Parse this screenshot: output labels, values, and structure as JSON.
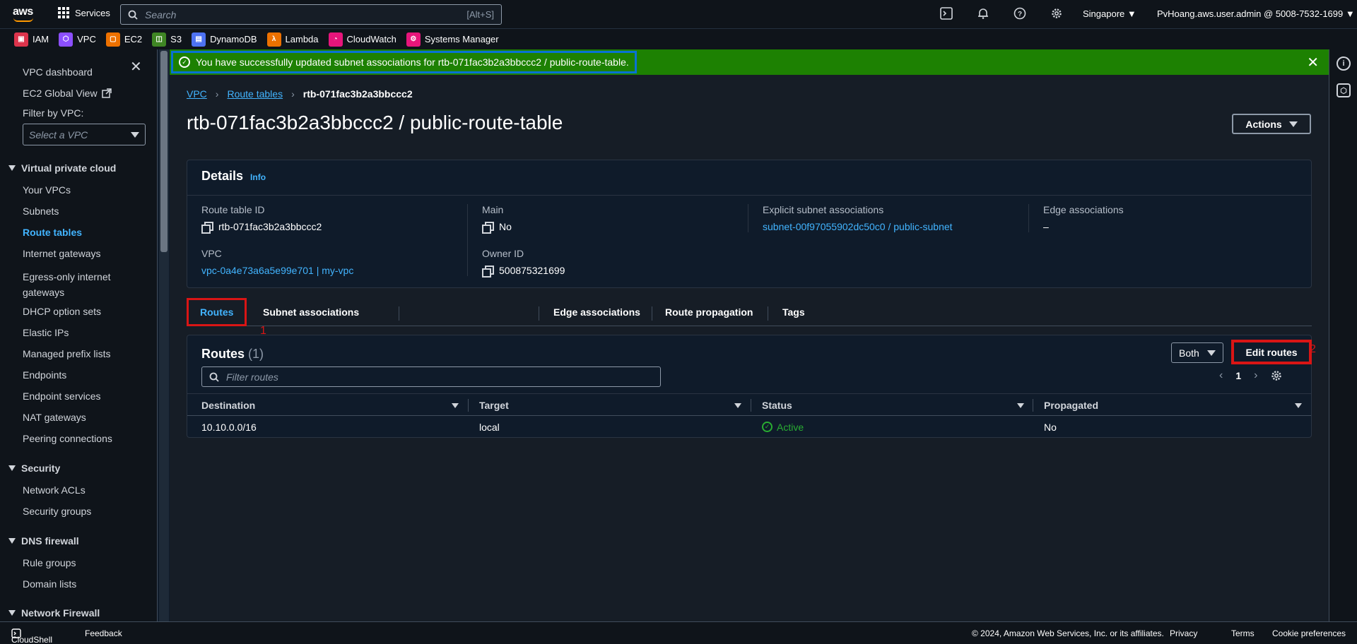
{
  "topnav": {
    "services_label": "Services",
    "search_placeholder": "Search",
    "search_shortcut": "[Alt+S]",
    "region": "Singapore ▼",
    "account": "PvHoang.aws.user.admin @ 5008-7532-1699 ▼"
  },
  "favorites": [
    {
      "label": "IAM",
      "color": "#dd344c"
    },
    {
      "label": "VPC",
      "color": "#8c4fff"
    },
    {
      "label": "EC2",
      "color": "#ed7100"
    },
    {
      "label": "S3",
      "color": "#3f8624"
    },
    {
      "label": "DynamoDB",
      "color": "#4d72f3"
    },
    {
      "label": "Lambda",
      "color": "#ed7100"
    },
    {
      "label": "CloudWatch",
      "color": "#e7157b"
    },
    {
      "label": "Systems Manager",
      "color": "#e7157b"
    }
  ],
  "sidebar": {
    "dashboard": "VPC dashboard",
    "ec2_global_view": "EC2 Global View",
    "filter_label": "Filter by VPC:",
    "filter_placeholder": "Select a VPC",
    "sections": {
      "vpc": "Virtual private cloud",
      "security": "Security",
      "dns": "DNS firewall",
      "network_firewall": "Network Firewall"
    },
    "items": {
      "your_vpcs": "Your VPCs",
      "subnets": "Subnets",
      "route_tables": "Route tables",
      "internet_gateways": "Internet gateways",
      "egress_only_1": "Egress-only internet",
      "egress_only_2": "gateways",
      "dhcp": "DHCP option sets",
      "elastic_ips": "Elastic IPs",
      "prefix_lists": "Managed prefix lists",
      "endpoints": "Endpoints",
      "endpoint_services": "Endpoint services",
      "nat": "NAT gateways",
      "peering": "Peering connections",
      "nacls": "Network ACLs",
      "security_groups": "Security groups",
      "rule_groups": "Rule groups",
      "domain_lists": "Domain lists"
    }
  },
  "flash": {
    "message": "You have successfully updated subnet associations for rtb-071fac3b2a3bbccc2 / public-route-table."
  },
  "breadcrumb": {
    "vpc": "VPC",
    "route_tables": "Route tables",
    "current": "rtb-071fac3b2a3bbccc2"
  },
  "page": {
    "title": "rtb-071fac3b2a3bbccc2 / public-route-table",
    "actions_label": "Actions"
  },
  "details": {
    "title": "Details",
    "info": "Info",
    "route_table_id_label": "Route table ID",
    "route_table_id": "rtb-071fac3b2a3bbccc2",
    "main_label": "Main",
    "main": "No",
    "explicit_label": "Explicit subnet associations",
    "explicit": "subnet-00f97055902dc50c0 / public-subnet",
    "edge_label": "Edge associations",
    "edge": "–",
    "vpc_label": "VPC",
    "vpc": "vpc-0a4e73a6a5e99e701 | my-vpc",
    "owner_label": "Owner ID",
    "owner": "500875321699"
  },
  "tabs": {
    "routes": "Routes",
    "subnet_assoc": "Subnet associations",
    "edge_assoc": "Edge associations",
    "propagation": "Route propagation",
    "tags": "Tags"
  },
  "annotations": {
    "one": "1",
    "two": "2"
  },
  "routes": {
    "title": "Routes",
    "count": "(1)",
    "filter_value": "Both",
    "edit_label": "Edit routes",
    "filter_placeholder": "Filter routes",
    "page": "1",
    "columns": {
      "destination": "Destination",
      "target": "Target",
      "status": "Status",
      "propagated": "Propagated"
    },
    "rows": [
      {
        "destination": "10.10.0.0/16",
        "target": "local",
        "status": "Active",
        "propagated": "No"
      }
    ]
  },
  "footer": {
    "cloudshell": "CloudShell",
    "feedback": "Feedback",
    "copyright": "© 2024, Amazon Web Services, Inc. or its affiliates.",
    "privacy": "Privacy",
    "terms": "Terms",
    "cookies": "Cookie preferences"
  }
}
